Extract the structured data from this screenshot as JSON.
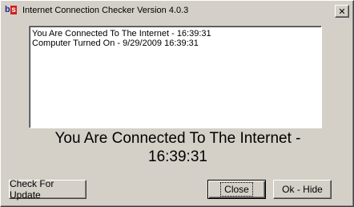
{
  "window": {
    "title": "Internet Connection Checker Version 4.0.3",
    "close_label": "✕",
    "app_icon_letters": [
      "b",
      "s"
    ]
  },
  "log": {
    "lines": [
      "You Are Connected To The Internet - 16:39:31",
      "Computer Turned On - 9/29/2009 16:39:31"
    ]
  },
  "status": {
    "line1": "You Are Connected To The Internet -",
    "line2": "16:39:31"
  },
  "buttons": {
    "update": "Check For Update",
    "close": "Close",
    "ok_hide": "Ok - Hide"
  },
  "colors": {
    "window_bg": "#d4d0c8",
    "icon_blue": "#1a2a8c",
    "icon_red": "#d21f1f"
  }
}
